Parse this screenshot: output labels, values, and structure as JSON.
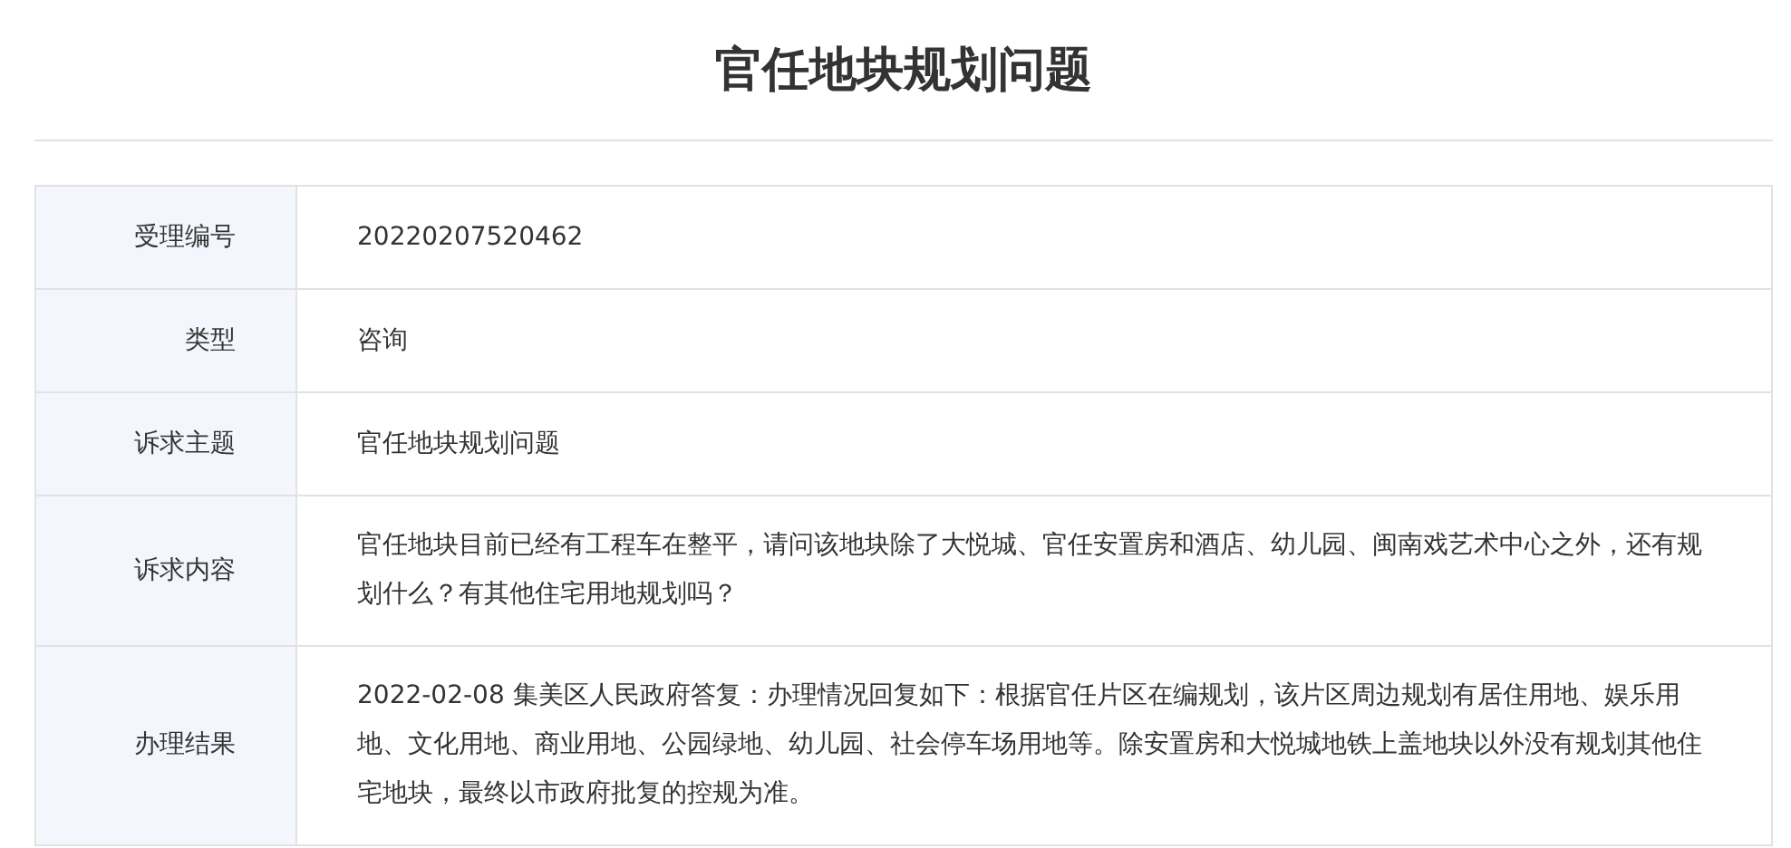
{
  "title": "官任地块规划问题",
  "rows": [
    {
      "label": "受理编号",
      "value": "20220207520462"
    },
    {
      "label": "类型",
      "value": "咨询"
    },
    {
      "label": "诉求主题",
      "value": "官任地块规划问题"
    },
    {
      "label": "诉求内容",
      "value": "官任地块目前已经有工程车在整平，请问该地块除了大悦城、官任安置房和酒店、幼儿园、闽南戏艺术中心之外，还有规划什么？有其他住宅用地规划吗？"
    },
    {
      "label": "办理结果",
      "value": "2022-02-08 集美区人民政府答复：办理情况回复如下：根据官任片区在编规划，该片区周边规划有居住用地、娱乐用地、文化用地、商业用地、公园绿地、幼儿园、社会停车场用地等。除安置房和大悦城地铁上盖地块以外没有规划其他住宅地块，最终以市政府批复的控规为准。"
    }
  ]
}
